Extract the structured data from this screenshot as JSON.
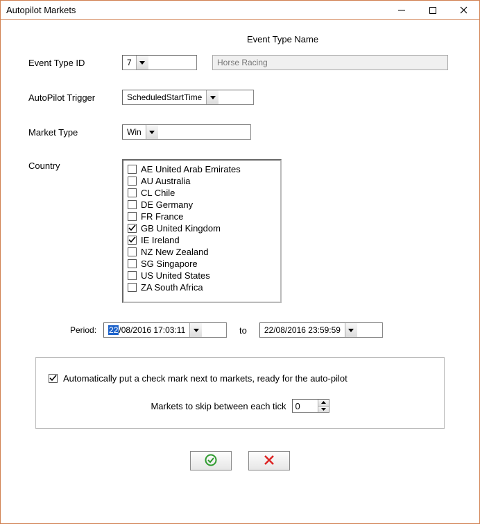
{
  "window": {
    "title": "Autopilot Markets"
  },
  "labels": {
    "eventTypeId": "Event Type ID",
    "eventTypeName": "Event Type Name",
    "autopilotTrigger": "AutoPilot Trigger",
    "marketType": "Market Type",
    "country": "Country",
    "period": "Period:",
    "to": "to",
    "autoCheck": "Automatically put a check mark next to markets, ready for the auto-pilot",
    "marketsSkip": "Markets to skip between each tick"
  },
  "eventTypeId": {
    "value": "7"
  },
  "eventTypeName": {
    "value": "Horse Racing"
  },
  "autopilotTrigger": {
    "value": "ScheduledStartTime"
  },
  "marketType": {
    "value": "Win"
  },
  "countries": [
    {
      "label": "AE United Arab Emirates",
      "checked": false
    },
    {
      "label": "AU Australia",
      "checked": false
    },
    {
      "label": "CL Chile",
      "checked": false
    },
    {
      "label": "DE Germany",
      "checked": false
    },
    {
      "label": "FR France",
      "checked": false
    },
    {
      "label": "GB United Kingdom",
      "checked": true
    },
    {
      "label": "IE Ireland",
      "checked": true
    },
    {
      "label": "NZ New Zealand",
      "checked": false
    },
    {
      "label": "SG Singapore",
      "checked": false
    },
    {
      "label": "US United States",
      "checked": false
    },
    {
      "label": "ZA South Africa",
      "checked": false
    }
  ],
  "period": {
    "from_selDay": "22",
    "from_rest": "/08/2016  17:03:11",
    "to_full": "22/08/2016  23:59:59"
  },
  "autoCheck": {
    "checked": true
  },
  "marketsSkip": {
    "value": "0"
  },
  "icons": {
    "ok": "ok-icon",
    "cancel": "cancel-icon"
  }
}
